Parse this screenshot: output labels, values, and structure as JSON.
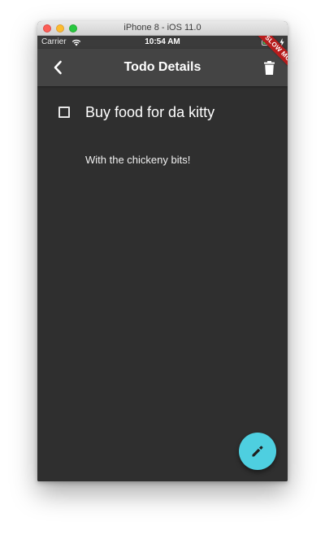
{
  "window": {
    "title": "iPhone 8 - iOS 11.0"
  },
  "status_bar": {
    "carrier": "Carrier",
    "time": "10:54 AM",
    "wifi_icon": "wifi-icon",
    "battery_icon": "battery-icon",
    "charging_icon": "bolt-icon",
    "battery_level": 1.0
  },
  "app_bar": {
    "title": "Todo Details",
    "back_icon": "chevron-left-icon",
    "delete_icon": "trash-icon"
  },
  "debug_banner": {
    "label": "SLOW MODE"
  },
  "todo": {
    "title": "Buy food for da kitty",
    "note": "With the chickeny bits!",
    "completed": false
  },
  "fab": {
    "icon": "pencil-icon"
  },
  "colors": {
    "background": "#2f2f2f",
    "app_bar": "#444444",
    "accent": "#4ecfe0",
    "banner": "#b71c1c"
  }
}
